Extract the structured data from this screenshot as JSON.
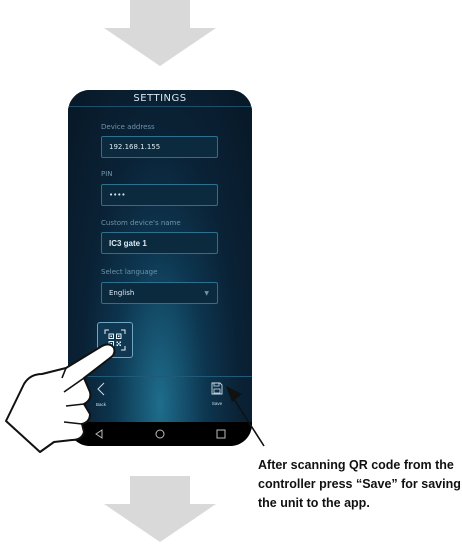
{
  "screen_title": "SETTINGS",
  "device_address": {
    "label": "Device address",
    "value": "192.168.1.155"
  },
  "pin": {
    "label": "PIN",
    "value": "••••"
  },
  "custom_name": {
    "label": "Custom device's name",
    "value": "IC3 gate 1"
  },
  "language": {
    "label": "Select language",
    "value": "English"
  },
  "actions": {
    "back_label": "Back",
    "save_label": "Save"
  },
  "caption": "After scanning QR code from the controller press “Save” for saving the unit to the app.",
  "colors": {
    "arrow": "#d9d9d9",
    "screen_bg": "#0a2236",
    "field_border": "#2d6f8e",
    "text_muted": "#6f93aa"
  },
  "icons": [
    "qr-code-icon",
    "back-chevron-icon",
    "save-icon",
    "nav-back-icon",
    "nav-home-icon",
    "nav-recents-icon"
  ]
}
